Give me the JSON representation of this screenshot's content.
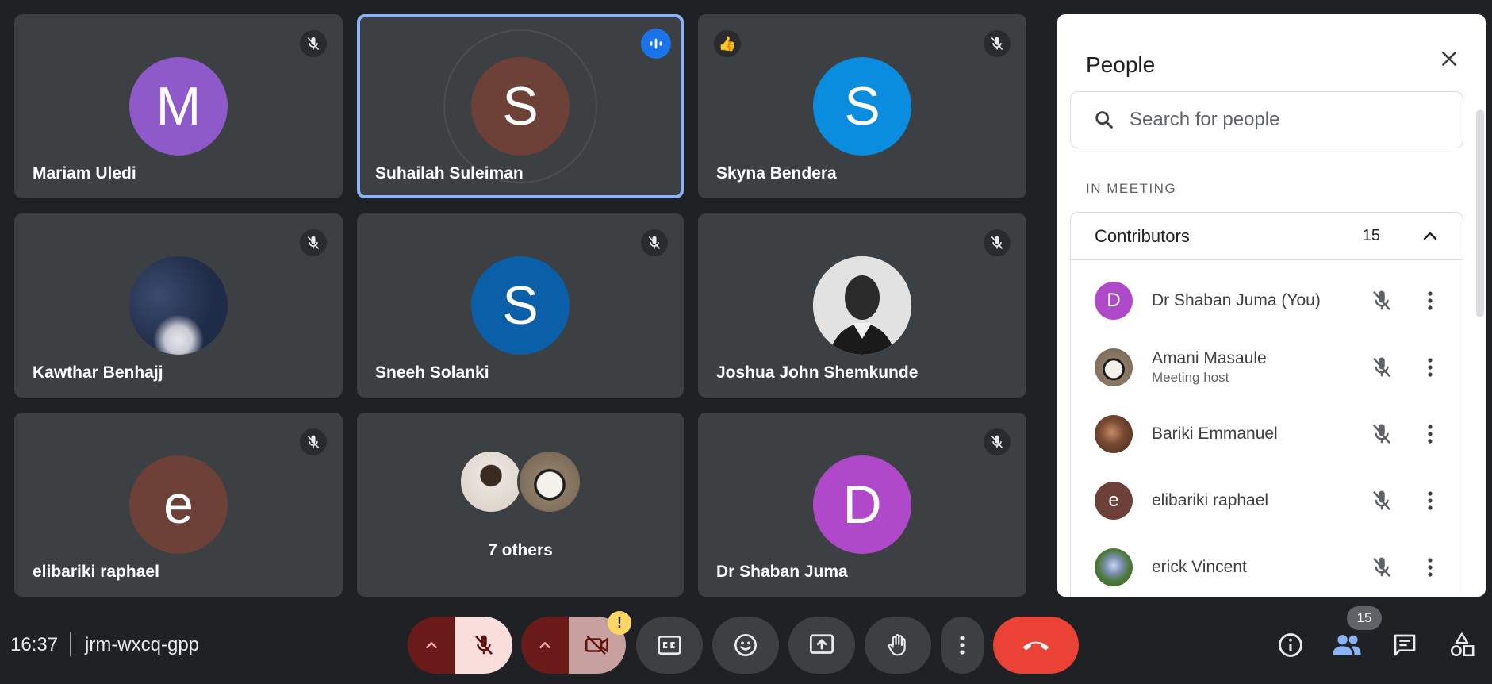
{
  "tiles": [
    {
      "name": "Mariam Uledi",
      "initial": "M",
      "color": "#8e59c8",
      "muted": true
    },
    {
      "name": "Suhailah Suleiman",
      "initial": "S",
      "color": "#6d4138",
      "speaking": true
    },
    {
      "name": "Skyna Bendera",
      "initial": "S",
      "color": "#0a8dde",
      "muted": true,
      "reaction": "👍"
    },
    {
      "name": "Kawthar Benhajj",
      "initial": "",
      "photo": "clouds",
      "muted": true
    },
    {
      "name": "Sneeh Solanki",
      "initial": "S",
      "color": "#0b5fa8",
      "muted": true
    },
    {
      "name": "Joshua John Shemkunde",
      "initial": "",
      "photo": "portrait",
      "muted": true
    },
    {
      "name": "elibariki raphael",
      "initial": "e",
      "color": "#6d4138",
      "muted": true
    },
    {
      "name": "Dr Shaban Juma",
      "initial": "D",
      "color": "#b049c9",
      "muted": true
    }
  ],
  "others": {
    "label": "7 others"
  },
  "panel": {
    "title": "People",
    "search_placeholder": "Search for people",
    "section_label": "IN MEETING",
    "group": {
      "name": "Contributors",
      "count": "15"
    },
    "people": [
      {
        "name": "Dr Shaban Juma (You)",
        "role": "",
        "initial": "D",
        "color": "#b049c9"
      },
      {
        "name": "Amani Masaule",
        "role": "Meeting host",
        "initial": "",
        "photo": "watch"
      },
      {
        "name": "Bariki Emmanuel",
        "role": "",
        "initial": "",
        "photo": "face"
      },
      {
        "name": "elibariki raphael",
        "role": "",
        "initial": "e",
        "color": "#6d4138"
      },
      {
        "name": "erick Vincent",
        "role": "",
        "initial": "",
        "photo": "outdoor"
      }
    ]
  },
  "bottom": {
    "time": "16:37",
    "meeting_code": "jrm-wxcq-gpp",
    "participant_count": "15",
    "warning": "!"
  }
}
